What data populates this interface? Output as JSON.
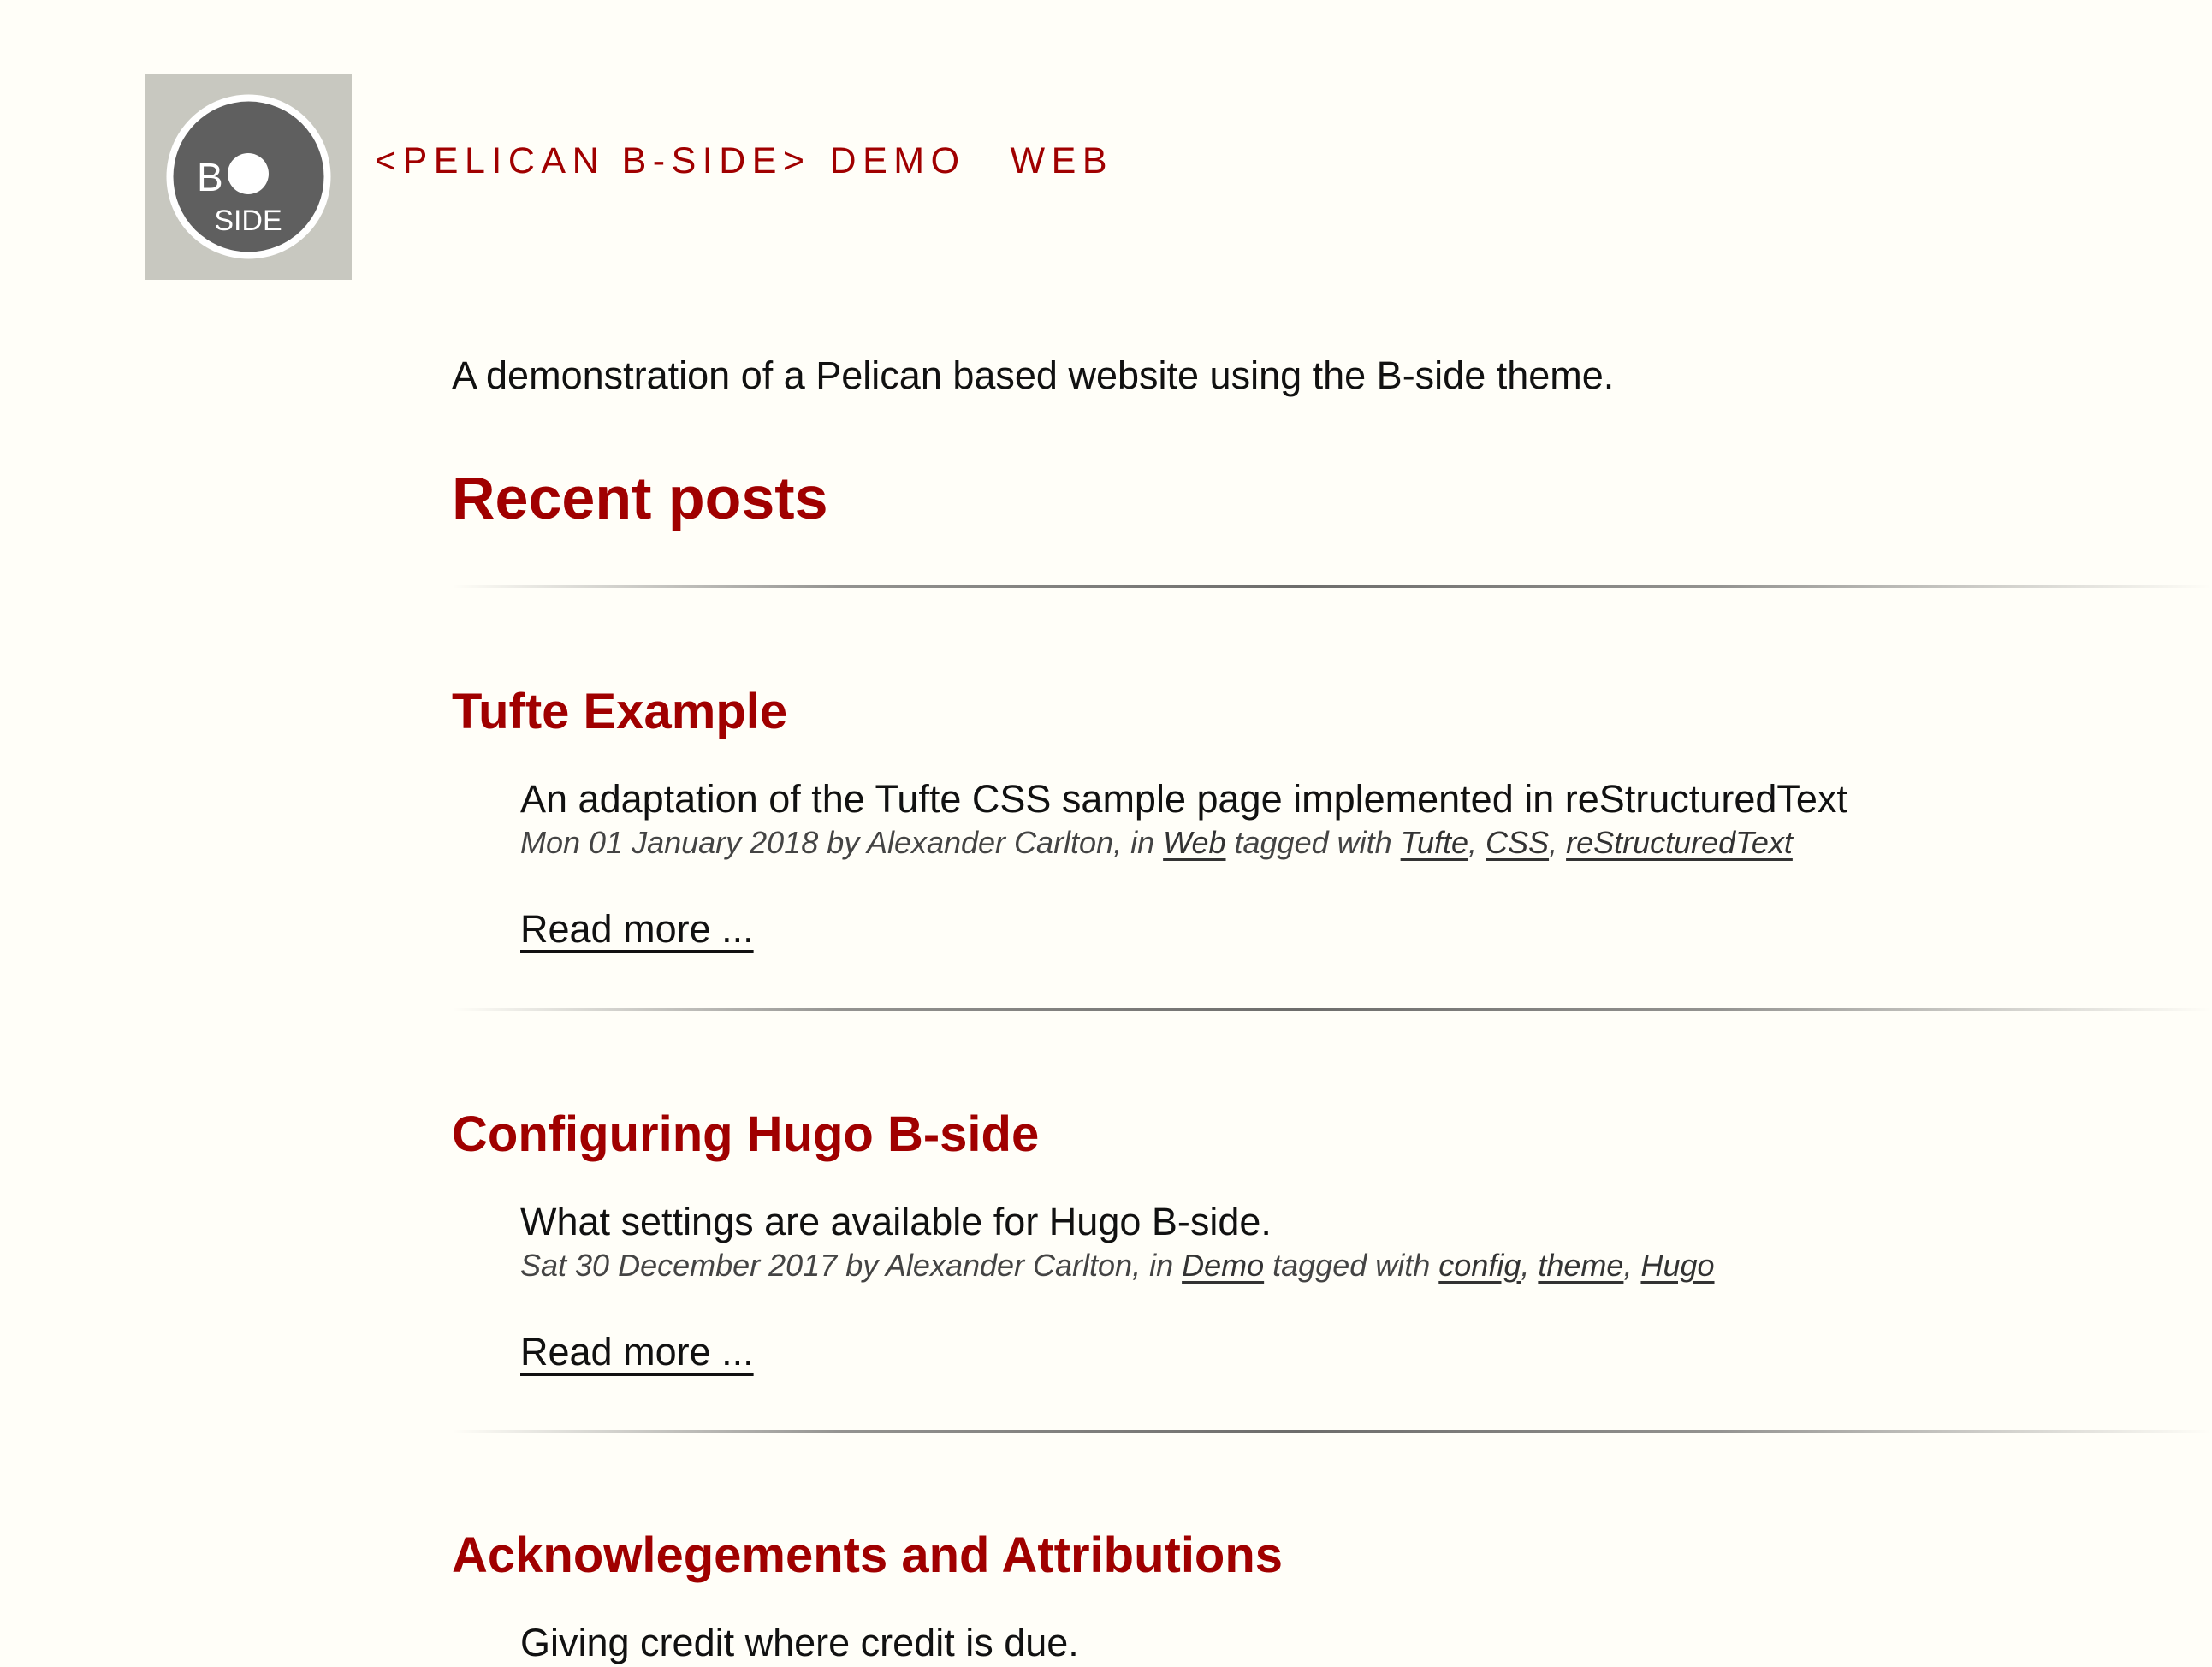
{
  "logo": {
    "letter": "B",
    "word": "SIDE"
  },
  "nav": {
    "brand": "<PELICAN B-SIDE>",
    "items": [
      {
        "label": "DEMO"
      },
      {
        "label": "WEB"
      }
    ]
  },
  "tagline": "A demonstration of a Pelican based website using the B-side theme.",
  "section_title": "Recent posts",
  "posts": [
    {
      "title": "Tufte Example",
      "summary": "An adaptation of the Tufte CSS sample page implemented in reStructuredText",
      "date": "Mon 01 January 2018",
      "by_text": " by Alexander Carlton, in ",
      "category": "Web",
      "tagged_text": " tagged with ",
      "tags": [
        "Tufte",
        "CSS",
        "reStructuredText"
      ],
      "read_more": "Read more ..."
    },
    {
      "title": "Configuring Hugo B-side",
      "summary": "What settings are available for Hugo B-side.",
      "date": "Sat 30 December 2017",
      "by_text": " by Alexander Carlton, in ",
      "category": "Demo",
      "tagged_text": " tagged with ",
      "tags": [
        "config",
        "theme",
        "Hugo"
      ],
      "read_more": "Read more ..."
    },
    {
      "title": "Acknowlegements and Attributions",
      "summary": "Giving credit where credit is due."
    }
  ],
  "colors": {
    "accent": "#a00000",
    "background": "#fffef8",
    "text": "#111111",
    "meta": "#444444",
    "logo_bg": "#c8c8c0",
    "logo_disc": "#5f5f5f"
  }
}
